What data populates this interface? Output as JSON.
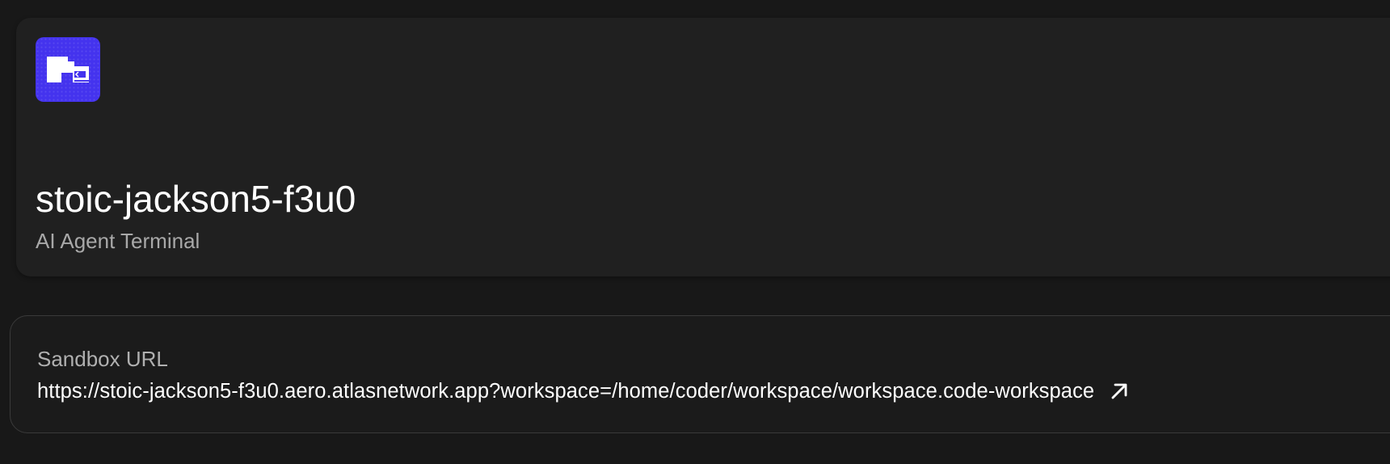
{
  "workspace": {
    "name": "stoic-jackson5-f3u0",
    "subtitle": "AI Agent Terminal",
    "logo_icon": "app-logo-icon",
    "accent_color": "#4433ee"
  },
  "sandbox": {
    "label": "Sandbox URL",
    "url": "https://stoic-jackson5-f3u0.aero.atlasnetwork.app?workspace=/home/coder/workspace/workspace.code-workspace",
    "link_icon": "external-link-icon"
  }
}
